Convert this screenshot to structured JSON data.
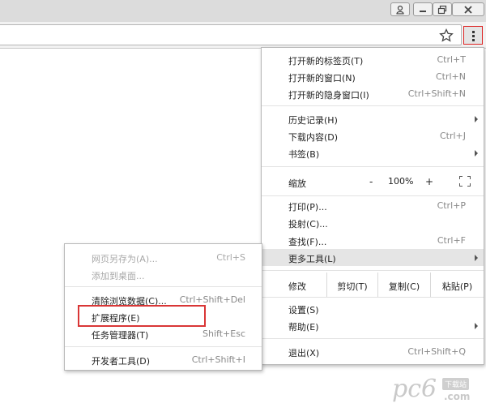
{
  "main_menu": {
    "items_top": [
      {
        "label": "打开新的标签页(T)",
        "shortcut": "Ctrl+T"
      },
      {
        "label": "打开新的窗口(N)",
        "shortcut": "Ctrl+N"
      },
      {
        "label": "打开新的隐身窗口(I)",
        "shortcut": "Ctrl+Shift+N"
      }
    ],
    "items_history": [
      {
        "label": "历史记录(H)",
        "shortcut": ""
      },
      {
        "label": "下载内容(D)",
        "shortcut": "Ctrl+J"
      },
      {
        "label": "书签(B)",
        "shortcut": ""
      }
    ],
    "zoom": {
      "label": "缩放",
      "minus": "-",
      "value": "100%",
      "plus": "+"
    },
    "items_tools": [
      {
        "label": "打印(P)...",
        "shortcut": "Ctrl+P"
      },
      {
        "label": "投射(C)...",
        "shortcut": ""
      },
      {
        "label": "查找(F)...",
        "shortcut": "Ctrl+F"
      },
      {
        "label": "更多工具(L)",
        "shortcut": ""
      }
    ],
    "edit": {
      "label": "修改",
      "cut": "剪切(T)",
      "copy": "复制(C)",
      "paste": "粘贴(P)"
    },
    "items_settings": [
      {
        "label": "设置(S)",
        "shortcut": ""
      },
      {
        "label": "帮助(E)",
        "shortcut": ""
      }
    ],
    "exit": {
      "label": "退出(X)",
      "shortcut": "Ctrl+Shift+Q"
    }
  },
  "more_tools_submenu": {
    "items": [
      {
        "label": "网页另存为(A)...",
        "shortcut": "Ctrl+S"
      },
      {
        "label": "添加到桌面...",
        "shortcut": ""
      },
      {
        "label": "清除浏览数据(C)...",
        "shortcut": "Ctrl+Shift+Del"
      },
      {
        "label": "扩展程序(E)",
        "shortcut": ""
      },
      {
        "label": "任务管理器(T)",
        "shortcut": "Shift+Esc"
      },
      {
        "label": "开发者工具(D)",
        "shortcut": "Ctrl+Shift+I"
      }
    ]
  },
  "watermark": {
    "logo": "pc6",
    "tag": "下载站",
    "domain": ".com"
  },
  "colors": {
    "highlight_box": "#d93636",
    "hover_row": "#e5e5e5"
  }
}
